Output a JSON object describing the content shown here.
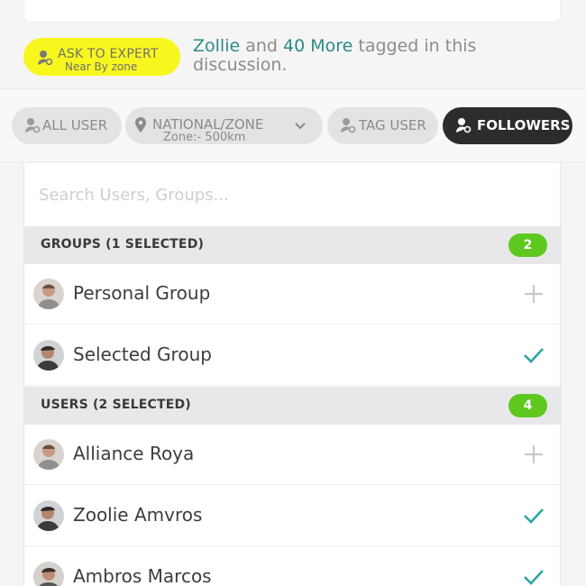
{
  "expert": {
    "button_title": "ASK TO EXPERT",
    "button_sub": "Near By zone",
    "tag_name": "Zollie",
    "tag_and": "and",
    "tag_more": "40 More",
    "tag_tail": "tagged in this discussion."
  },
  "filters": {
    "all_user": "ALL USER",
    "zone_label": "NATIONAL/ZONE",
    "zone_sub": "Zone:- 500km",
    "tag_user": "TAG USER",
    "followers": "FOLLOWERS",
    "active": "FOLLOWERS"
  },
  "search": {
    "placeholder": "Search Users, Groups..."
  },
  "groups": {
    "header": "GROUPS (1 SELECTED)",
    "count": "2",
    "items": [
      {
        "label": "Personal Group",
        "state": "add"
      },
      {
        "label": "Selected Group",
        "state": "selected"
      }
    ]
  },
  "users": {
    "header": "USERS (2 SELECTED)",
    "count": "4",
    "items": [
      {
        "label": "Alliance Roya",
        "state": "add"
      },
      {
        "label": "Zoolie Amvros",
        "state": "selected"
      },
      {
        "label": "Ambros Marcos",
        "state": "selected"
      }
    ]
  },
  "colors": {
    "accent_green": "#5ec81f",
    "check_teal": "#2aa7a0",
    "expert_yellow": "#f7f71f",
    "active_chip": "#2c2c2e",
    "link_teal": "#2e8b86"
  }
}
